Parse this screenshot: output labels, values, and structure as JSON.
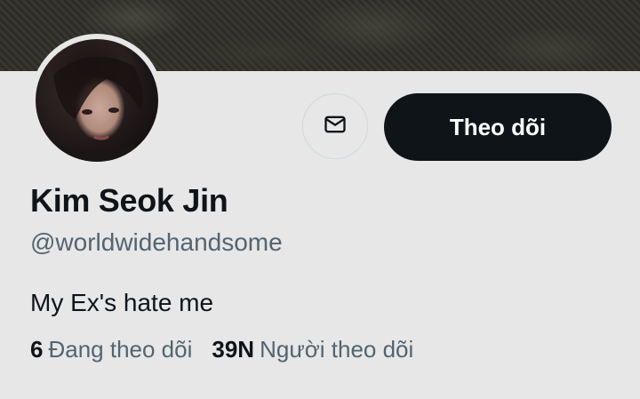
{
  "profile": {
    "name": "Kim Seok Jin",
    "handle": "@worldwidehandsome",
    "bio": "My Ex's hate me"
  },
  "actions": {
    "message_icon": "envelope-icon",
    "follow_label": "Theo dõi"
  },
  "stats": {
    "following_count": "6",
    "following_label": "Đang theo dõi",
    "followers_count": "39N",
    "followers_label": "Người theo dõi"
  },
  "colors": {
    "button_dark": "#0f1419",
    "secondary_text": "#536471",
    "background": "#e7e7e7"
  }
}
